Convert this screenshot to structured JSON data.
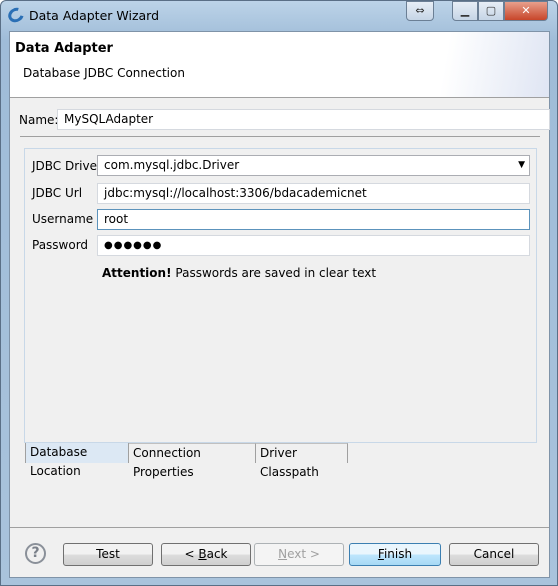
{
  "window": {
    "title": "Data Adapter Wizard",
    "controls": [
      "resize",
      "minimize",
      "maximize",
      "close"
    ]
  },
  "header": {
    "title": "Data Adapter",
    "subtitle": "Database JDBC Connection"
  },
  "name": {
    "label": "Name:",
    "value": "MySQLAdapter"
  },
  "form": {
    "driver": {
      "label": "JDBC Driver",
      "value": "com.mysql.jdbc.Driver"
    },
    "url": {
      "label": "JDBC Url",
      "value": "jdbc:mysql://localhost:3306/bdacademicnet"
    },
    "username": {
      "label": "Username",
      "value": "root"
    },
    "password": {
      "label": "Password",
      "value": "●●●●●●"
    },
    "attention_strong": "Attention!",
    "attention_text": "Passwords are saved in clear text"
  },
  "tabs": [
    {
      "label": "Database Location",
      "selected": true
    },
    {
      "label": "Connection Properties"
    },
    {
      "label": "Driver Classpath"
    }
  ],
  "buttons": {
    "test": "Test",
    "back_prefix": "< ",
    "back_key": "B",
    "back_rest": "ack",
    "next_key": "N",
    "next_rest": "ext >",
    "finish_key": "F",
    "finish_rest": "inish",
    "cancel": "Cancel"
  }
}
